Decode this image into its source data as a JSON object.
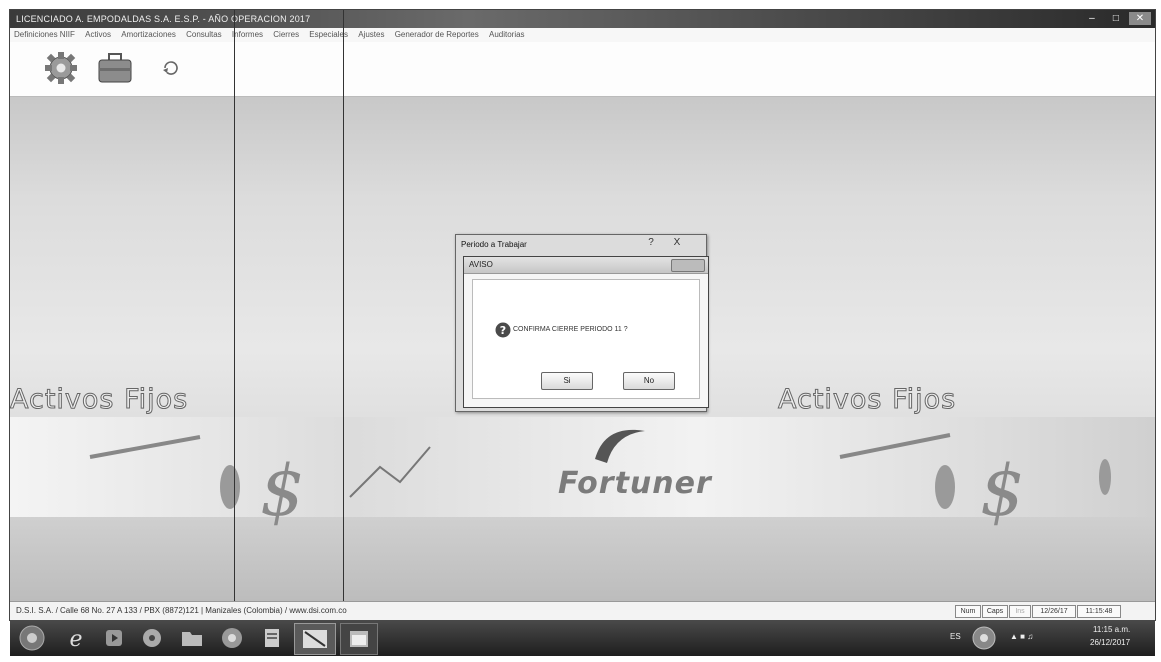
{
  "window": {
    "title": "LICENCIADO A. EMPODALDAS S.A. E.S.P. - AÑO OPERACION 2017"
  },
  "menu": [
    "Definiciones NIIF",
    "Activos",
    "Amortizaciones",
    "Consultas",
    "Informes",
    "Cierres",
    "Especiales",
    "Ajustes",
    "Generador de Reportes",
    "Auditorias"
  ],
  "toolbar": {
    "icons": [
      "gear-icon",
      "briefcase-icon",
      "refresh-icon"
    ]
  },
  "background": {
    "brand_left": "Activos Fijos",
    "brand_right": "Activos Fijos",
    "logo_text": "Fortuner"
  },
  "dialog_back": {
    "title": "Periodo a Trabajar",
    "help": "?",
    "close": "X"
  },
  "dialog": {
    "title": "AVISO",
    "message": "CONFIRMA CIERRE PERIODO 11 ?",
    "yes_label": "Si",
    "no_label": "No",
    "icon": "question-icon"
  },
  "status": {
    "text": "D.S.I. S.A. / Calle 68 No. 27 A 133 / PBX (8872)121 | Manizales (Colombia) / www.dsi.com.co",
    "num": "Num",
    "caps": "Caps",
    "ins": "Ins",
    "date": "12/26/17",
    "time": "11:15:48"
  },
  "taskbar": {
    "clock_time": "11:15 a.m.",
    "clock_date": "26/12/2017",
    "lang": "ES"
  }
}
